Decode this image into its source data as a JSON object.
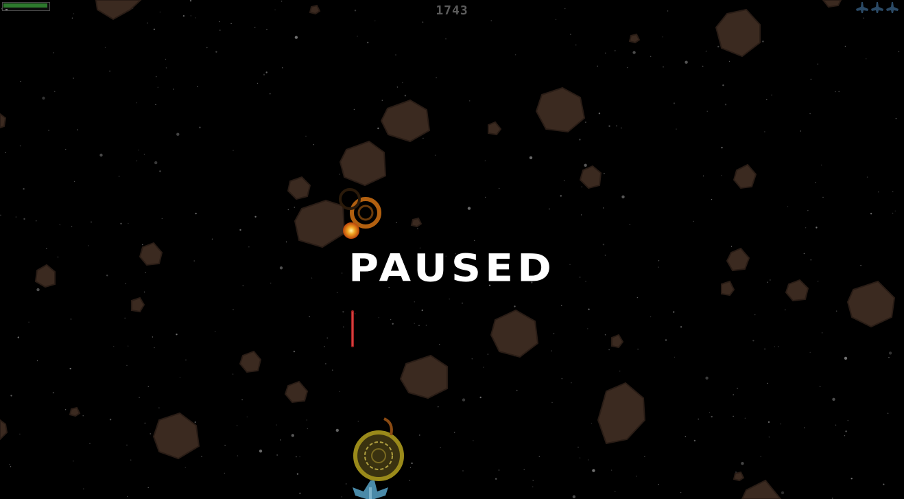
{
  "hud": {
    "score": "1743",
    "lives_count": 3,
    "health": 0.97,
    "shield": 0.0,
    "health_color": "#2d7a2d"
  },
  "overlay": {
    "paused_label": "PAUSED"
  },
  "colors": {
    "background": "#000000",
    "asteroid": "#3b2a20",
    "asteroid_shade": "#2a1d16",
    "explosion_orange": "#c56a12",
    "explosion_core": "#f0a020",
    "shield_ring": "#9a8a1a",
    "laser": "#a02020",
    "player_ship": "#4a8aa8",
    "life_icon": "#2b4a66"
  },
  "icons": {
    "life": "ship-icon",
    "player": "player-ship-icon"
  }
}
